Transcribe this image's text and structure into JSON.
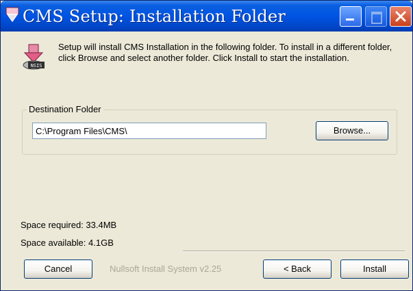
{
  "window": {
    "title": "CMS Setup: Installation Folder"
  },
  "intro_text": "Setup will install CMS Installation in the following folder. To install in a different folder, click Browse and select another folder. Click Install to start the installation.",
  "destination": {
    "group_label": "Destination Folder",
    "path_value": "C:\\Program Files\\CMS\\",
    "browse_label": "Browse..."
  },
  "space": {
    "required": "Space required: 33.4MB",
    "available": "Space available: 4.1GB"
  },
  "footer": {
    "cancel_label": "Cancel",
    "branding": "Nullsoft Install System v2.25",
    "back_label": "< Back",
    "install_label": "Install"
  },
  "icons": {
    "app": "installer-icon",
    "header": "nsis-installer-icon"
  },
  "colors": {
    "titlebar": "#0054e3",
    "dialog_bg": "#ece9d8",
    "close_button": "#c9411c"
  }
}
